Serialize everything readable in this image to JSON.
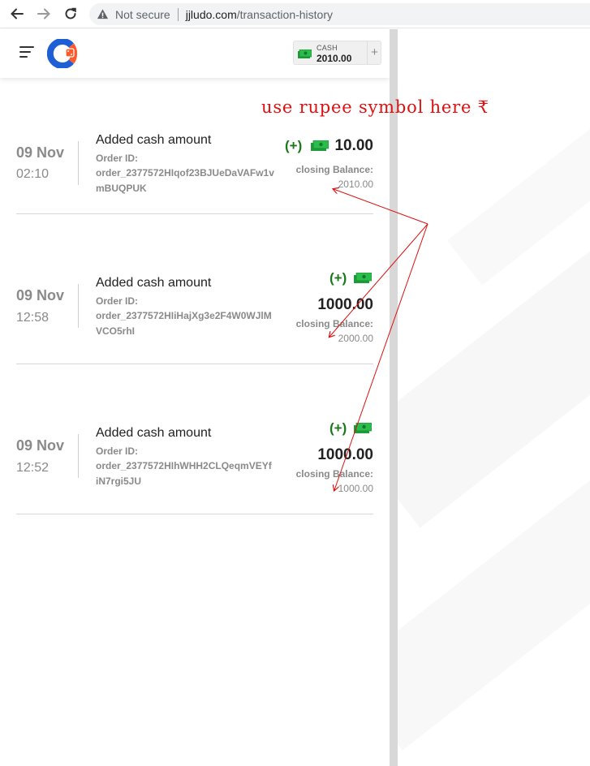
{
  "browser": {
    "security_label": "Not secure",
    "url_host": "jjludo.com",
    "url_path": "/transaction-history"
  },
  "header": {
    "wallet_label": "CASH",
    "wallet_amount": "2010.00",
    "wallet_add": "+"
  },
  "transactions": [
    {
      "date": "09 Nov",
      "time": "02:10",
      "title": "Added cash amount",
      "order_label": "Order ID:",
      "order_id": "order_2377572HIqof23BJUeDaVAFw1vmBUQPUK",
      "sign": "(+)",
      "amount": "10.00",
      "closing_label": "closing Balance:",
      "closing_value": "2010.00"
    },
    {
      "date": "09 Nov",
      "time": "12:58",
      "title": "Added cash amount",
      "order_label": "Order ID:",
      "order_id": "order_2377572HIiHajXg3e2F4W0WJlMVCO5rhI",
      "sign": "(+)",
      "amount": "1000.00",
      "closing_label": "closing Balance:",
      "closing_value": "2000.00"
    },
    {
      "date": "09 Nov",
      "time": "12:52",
      "title": "Added cash amount",
      "order_label": "Order ID:",
      "order_id": "order_2377572HIhWHH2CLQeqmVEYfiN7rgi5JU",
      "sign": "(+)",
      "amount": "1000.00",
      "closing_label": "closing Balance:",
      "closing_value": "1000.00"
    }
  ],
  "annotation": {
    "text": "use rupee symbol here ₹",
    "color": "#d11111"
  },
  "colors": {
    "positive": "#1a7a1a",
    "muted_text": "#8a8a8a",
    "cash_green": "#1e9e3a"
  }
}
